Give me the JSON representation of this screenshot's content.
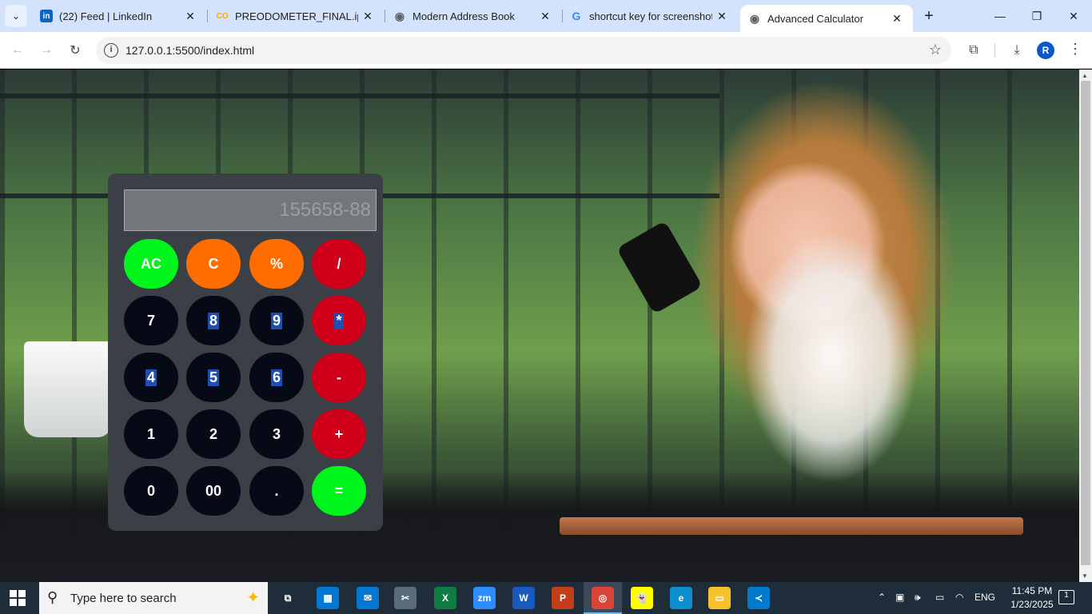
{
  "browser": {
    "tabs": [
      {
        "title": "(22) Feed | LinkedIn",
        "favicon": "linkedin-icon",
        "favicon_text": "in",
        "favicon_color": "#0a66c2"
      },
      {
        "title": "PREODOMETER_FINAL.ipynb",
        "favicon": "colab-icon",
        "favicon_text": "CO",
        "favicon_color": "#f9ab00"
      },
      {
        "title": "Modern Address Book",
        "favicon": "globe-icon",
        "favicon_text": "◉",
        "favicon_color": "#5f6368"
      },
      {
        "title": "shortcut key for screenshot in",
        "favicon": "google-icon",
        "favicon_text": "G",
        "favicon_color": "#4285f4"
      },
      {
        "title": "Advanced Calculator",
        "favicon": "globe-icon",
        "favicon_text": "◉",
        "favicon_color": "#5f6368"
      }
    ],
    "url": "127.0.0.1:5500/index.html",
    "profile_initial": "R"
  },
  "calculator": {
    "display": "155658-88",
    "keys": [
      {
        "label": "AC",
        "style": "green"
      },
      {
        "label": "C",
        "style": "orange"
      },
      {
        "label": "%",
        "style": "orange"
      },
      {
        "label": "/",
        "style": "red"
      },
      {
        "label": "7",
        "style": "dark"
      },
      {
        "label": "8",
        "style": "dark",
        "selected": true
      },
      {
        "label": "9",
        "style": "dark",
        "selected": true
      },
      {
        "label": "*",
        "style": "red",
        "selected": true
      },
      {
        "label": "4",
        "style": "dark",
        "selected": true
      },
      {
        "label": "5",
        "style": "dark",
        "selected": true
      },
      {
        "label": "6",
        "style": "dark",
        "selected": true
      },
      {
        "label": "-",
        "style": "red"
      },
      {
        "label": "1",
        "style": "dark"
      },
      {
        "label": "2",
        "style": "dark"
      },
      {
        "label": "3",
        "style": "dark"
      },
      {
        "label": "+",
        "style": "red"
      },
      {
        "label": "0",
        "style": "dark"
      },
      {
        "label": "00",
        "style": "dark"
      },
      {
        "label": ".",
        "style": "dark"
      },
      {
        "label": "=",
        "style": "green"
      }
    ]
  },
  "taskbar": {
    "search_placeholder": "Type here to search",
    "apps": [
      {
        "name": "task-view-icon",
        "text": "⧉",
        "color": "#1f2c3a"
      },
      {
        "name": "store-icon",
        "text": "▦",
        "color": "#0078d4"
      },
      {
        "name": "mail-icon",
        "text": "✉",
        "color": "#0078d4"
      },
      {
        "name": "snipping-tool-icon",
        "text": "✂",
        "color": "#5a6b7c"
      },
      {
        "name": "excel-icon",
        "text": "X",
        "color": "#107c41"
      },
      {
        "name": "zoom-icon",
        "text": "zm",
        "color": "#2d8cff"
      },
      {
        "name": "word-icon",
        "text": "W",
        "color": "#185abd"
      },
      {
        "name": "powerpoint-icon",
        "text": "P",
        "color": "#c43e1c"
      },
      {
        "name": "chrome-icon",
        "text": "◎",
        "color": "#db4437"
      },
      {
        "name": "snapchat-icon",
        "text": "👻",
        "color": "#fffc00"
      },
      {
        "name": "edge-icon",
        "text": "e",
        "color": "#0c8ecf"
      },
      {
        "name": "file-explorer-icon",
        "text": "▭",
        "color": "#f8c22c"
      },
      {
        "name": "vscode-icon",
        "text": "≺",
        "color": "#007acc"
      }
    ],
    "language": "ENG",
    "time": "11:45 PM",
    "date": "1/23/2025",
    "notification_count": "1"
  }
}
